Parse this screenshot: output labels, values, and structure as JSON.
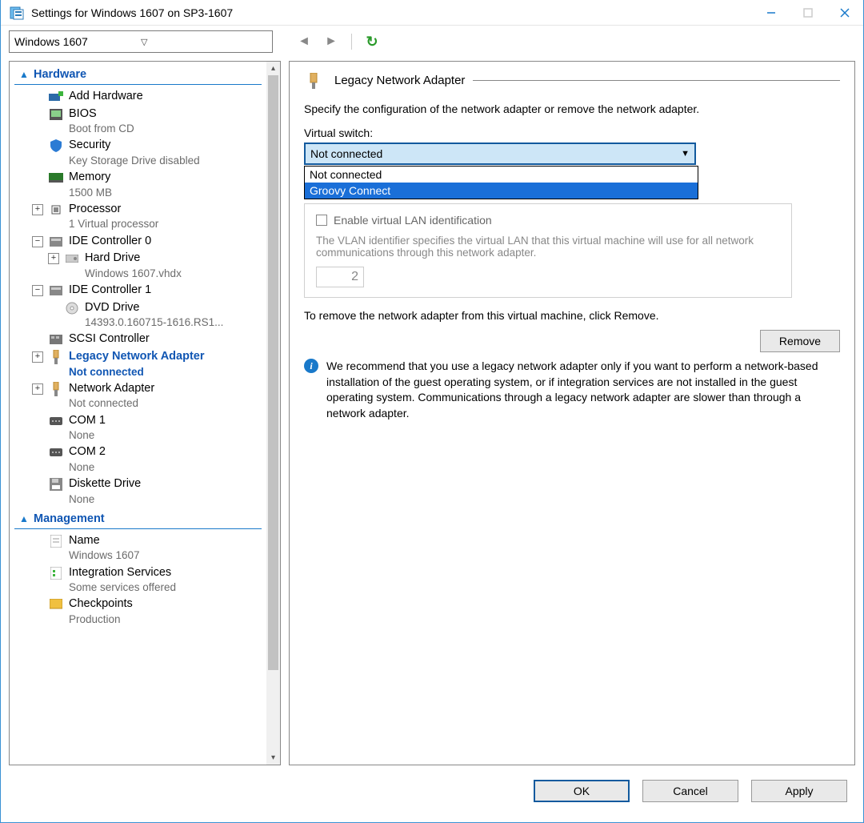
{
  "window": {
    "title": "Settings for Windows 1607 on SP3-1607"
  },
  "toolbar": {
    "vm_selector": "Windows 1607"
  },
  "tree": {
    "cat_hardware": "Hardware",
    "cat_management": "Management",
    "items": [
      {
        "label": "Add Hardware",
        "sub": ""
      },
      {
        "label": "BIOS",
        "sub": "Boot from CD"
      },
      {
        "label": "Security",
        "sub": "Key Storage Drive disabled"
      },
      {
        "label": "Memory",
        "sub": "1500 MB"
      },
      {
        "label": "Processor",
        "sub": "1 Virtual processor"
      },
      {
        "label": "IDE Controller 0",
        "sub": ""
      },
      {
        "label": "Hard Drive",
        "sub": "Windows 1607.vhdx"
      },
      {
        "label": "IDE Controller 1",
        "sub": ""
      },
      {
        "label": "DVD Drive",
        "sub": "14393.0.160715-1616.RS1..."
      },
      {
        "label": "SCSI Controller",
        "sub": ""
      },
      {
        "label": "Legacy Network Adapter",
        "sub": "Not connected"
      },
      {
        "label": "Network Adapter",
        "sub": "Not connected"
      },
      {
        "label": "COM 1",
        "sub": "None"
      },
      {
        "label": "COM 2",
        "sub": "None"
      },
      {
        "label": "Diskette Drive",
        "sub": "None"
      },
      {
        "label": "Name",
        "sub": "Windows 1607"
      },
      {
        "label": "Integration Services",
        "sub": "Some services offered"
      },
      {
        "label": "Checkpoints",
        "sub": "Production"
      }
    ]
  },
  "panel": {
    "title": "Legacy Network Adapter",
    "desc": "Specify the configuration of the network adapter or remove the network adapter.",
    "switch_label": "Virtual switch:",
    "switch_value": "Not connected",
    "options": [
      "Not connected",
      "Groovy Connect"
    ],
    "vlan_check": "Enable virtual LAN identification",
    "vlan_desc": "The VLAN identifier specifies the virtual LAN that this virtual machine will use for all network communications through this network adapter.",
    "vlan_id": "2",
    "remove_text": "To remove the network adapter from this virtual machine, click Remove.",
    "remove_btn": "Remove",
    "info": "We recommend that you use a legacy network adapter only if you want to perform a network-based installation of the guest operating system, or if integration services are not installed in the guest operating system. Communications through a legacy network adapter are slower than through a network adapter."
  },
  "footer": {
    "ok": "OK",
    "cancel": "Cancel",
    "apply": "Apply"
  }
}
